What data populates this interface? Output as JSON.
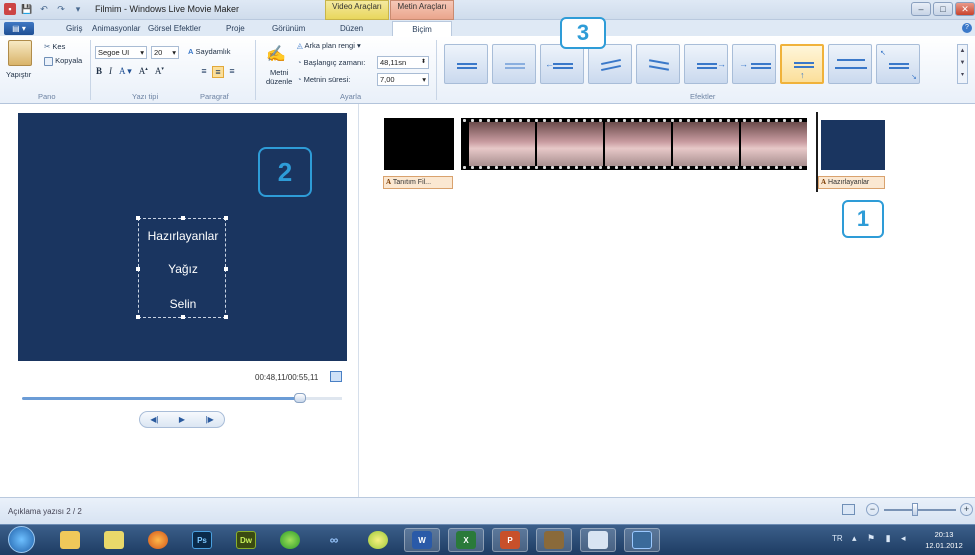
{
  "window": {
    "title": "Filmim - Windows Live Movie Maker",
    "context_tabs": [
      "Video Araçları",
      "Metin Araçları"
    ]
  },
  "tabs": [
    "Giriş",
    "Animasyonlar",
    "Görsel Efektler",
    "Proje",
    "Görünüm",
    "Düzen",
    "Biçim"
  ],
  "active_tab": "Biçim",
  "ribbon": {
    "pano": {
      "paste": "Yapıştır",
      "cut": "Kes",
      "copy": "Kopyala",
      "label": "Pano"
    },
    "font": {
      "family": "Segoe UI",
      "size": "20",
      "transparency": "Saydamlık",
      "label": "Yazı tipi"
    },
    "paragraph": {
      "label": "Paragraf"
    },
    "settings": {
      "edit_text_line1": "Metni",
      "edit_text_line2": "düzenle",
      "bg_color": "Arka plan rengi",
      "start_time_label": "Başlangıç zamanı:",
      "start_time_value": "48,11sn",
      "duration_label": "Metnin süresi:",
      "duration_value": "7,00",
      "label": "Ayarla"
    },
    "effects": {
      "label": "Efektler"
    }
  },
  "preview": {
    "lines": [
      "Hazırlayanlar",
      "Yağız",
      "Selin"
    ],
    "timecode": "00:48,11/00:55,11",
    "seek_progress": 0.87
  },
  "storyboard": {
    "caption1": "Tanıtım Fil...",
    "caption2": "Hazırlayanlar",
    "caption_glyph": "A"
  },
  "annotations": {
    "one": "1",
    "two": "2",
    "three": "3"
  },
  "status": {
    "text": "Açıklama yazısı 2 / 2"
  },
  "taskbar": {
    "apps": [
      "Ps",
      "Dw"
    ],
    "lang": "TR",
    "time": "20:13",
    "date": "12.01.2012"
  },
  "colors": {
    "preview_bg": "#1a3560",
    "annotation": "#2e9cd7",
    "selected_effect": "#f0b23a"
  }
}
